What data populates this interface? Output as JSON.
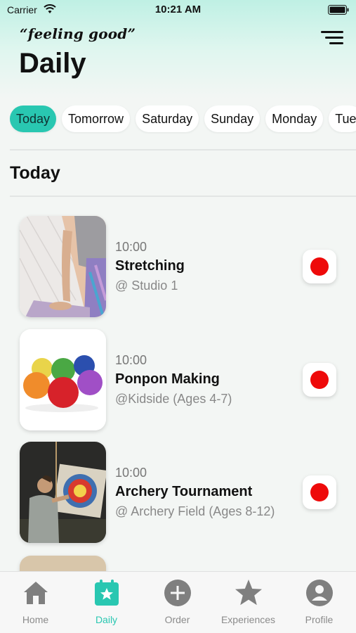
{
  "status_bar": {
    "carrier": "Carrier",
    "time": "10:21 AM"
  },
  "header": {
    "brand": "“feeling good”",
    "title": "Daily",
    "menu_icon": "filter-lines-icon"
  },
  "day_tabs": [
    "Today",
    "Tomorrow",
    "Saturday",
    "Sunday",
    "Monday",
    "Tue"
  ],
  "active_tab": "Today",
  "section_title": "Today",
  "events": [
    {
      "time": "10:00",
      "name": "Stretching",
      "location": "@ Studio 1",
      "image": "stretching-photo"
    },
    {
      "time": "10:00",
      "name": "Ponpon Making",
      "location": "@Kidside (Ages 4-7)",
      "image": "pompoms-photo"
    },
    {
      "time": "10:00",
      "name": "Archery Tournament",
      "location": "@ Archery Field  (Ages 8-12)",
      "image": "archery-photo"
    }
  ],
  "nav": {
    "home": "Home",
    "daily": "Daily",
    "order": "Order",
    "experiences": "Experiences",
    "profile": "Profile"
  },
  "colors": {
    "accent": "#29c7b1",
    "record": "#ee0a0a",
    "inactive_nav": "#8b8b8b"
  }
}
